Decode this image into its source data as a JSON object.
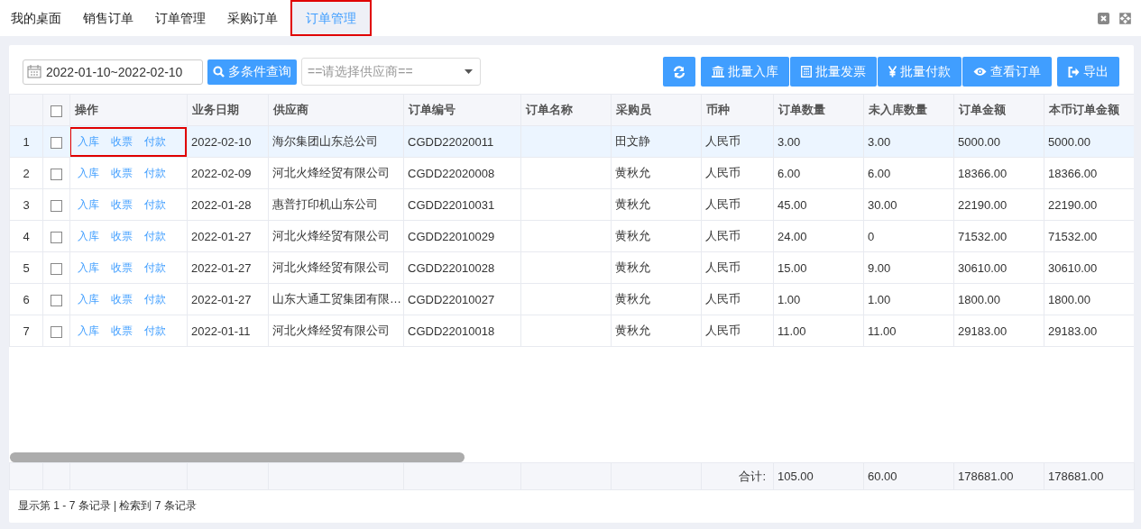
{
  "tabs": [
    {
      "label": "我的桌面",
      "selected": false
    },
    {
      "label": "销售订单",
      "selected": false
    },
    {
      "label": "订单管理",
      "selected": false
    },
    {
      "label": "采购订单",
      "selected": false
    },
    {
      "label": "订单管理",
      "selected": true,
      "highlighted": true
    }
  ],
  "toolbar": {
    "date_range": "2022-01-10~2022-02-10",
    "search_button": "多条件查询",
    "supplier_select": {
      "placeholder": "==请选择供应商=="
    },
    "buttons": [
      {
        "kind": "refresh"
      },
      {
        "kind": "bank",
        "label": "批量入库"
      },
      {
        "kind": "invoice",
        "label": "批量发票"
      },
      {
        "kind": "yen",
        "label": "批量付款"
      },
      {
        "kind": "eye",
        "label": "查看订单"
      },
      {
        "kind": "export",
        "label": "导出"
      }
    ]
  },
  "table": {
    "columns": [
      "",
      "",
      "操作",
      "业务日期",
      "供应商",
      "订单编号",
      "订单名称",
      "采购员",
      "币种",
      "订单数量",
      "未入库数量",
      "订单金额",
      "本币订单金额"
    ],
    "header_checked": false,
    "rows": [
      {
        "selected": true,
        "highlighted": true,
        "cells": [
          "1",
          {
            "checked": false
          },
          {
            "actions": [
              "入库",
              "收票",
              "付款"
            ]
          },
          "2022-02-10",
          "海尔集团山东总公司",
          "CGDD22020011",
          "",
          "田文静",
          "人民币",
          "3.00",
          "3.00",
          "5000.00",
          "5000.00"
        ]
      },
      {
        "selected": false,
        "highlighted": false,
        "cells": [
          "2",
          {
            "checked": false
          },
          {
            "actions": [
              "入库",
              "收票",
              "付款"
            ]
          },
          "2022-02-09",
          "河北火烽经贸有限公司",
          "CGDD22020008",
          "",
          "黄秋允",
          "人民币",
          "6.00",
          "6.00",
          "18366.00",
          "18366.00"
        ]
      },
      {
        "selected": false,
        "highlighted": false,
        "cells": [
          "3",
          {
            "checked": false
          },
          {
            "actions": [
              "入库",
              "收票",
              "付款"
            ]
          },
          "2022-01-28",
          "惠普打印机山东公司",
          "CGDD22010031",
          "",
          "黄秋允",
          "人民币",
          "45.00",
          "30.00",
          "22190.00",
          "22190.00"
        ]
      },
      {
        "selected": false,
        "highlighted": false,
        "cells": [
          "4",
          {
            "checked": false
          },
          {
            "actions": [
              "入库",
              "收票",
              "付款"
            ]
          },
          "2022-01-27",
          "河北火烽经贸有限公司",
          "CGDD22010029",
          "",
          "黄秋允",
          "人民币",
          "24.00",
          "0",
          "71532.00",
          "71532.00"
        ]
      },
      {
        "selected": false,
        "highlighted": false,
        "cells": [
          "5",
          {
            "checked": false
          },
          {
            "actions": [
              "入库",
              "收票",
              "付款"
            ]
          },
          "2022-01-27",
          "河北火烽经贸有限公司",
          "CGDD22010028",
          "",
          "黄秋允",
          "人民币",
          "15.00",
          "9.00",
          "30610.00",
          "30610.00"
        ]
      },
      {
        "selected": false,
        "highlighted": false,
        "cells": [
          "6",
          {
            "checked": false
          },
          {
            "actions": [
              "入库",
              "收票",
              "付款"
            ]
          },
          "2022-01-27",
          "山东大通工贸集团有限…",
          "CGDD22010027",
          "",
          "黄秋允",
          "人民币",
          "1.00",
          "1.00",
          "1800.00",
          "1800.00"
        ]
      },
      {
        "selected": false,
        "highlighted": false,
        "cells": [
          "7",
          {
            "checked": false
          },
          {
            "actions": [
              "入库",
              "收票",
              "付款"
            ]
          },
          "2022-01-11",
          "河北火烽经贸有限公司",
          "CGDD22010018",
          "",
          "黄秋允",
          "人民币",
          "11.00",
          "11.00",
          "29183.00",
          "29183.00"
        ]
      }
    ],
    "totals": {
      "label": "合计:",
      "values": [
        "105.00",
        "60.00",
        "178681.00",
        "178681.00"
      ]
    }
  },
  "status_bar": "显示第 1 - 7 条记录 | 检索到 7 条记录"
}
